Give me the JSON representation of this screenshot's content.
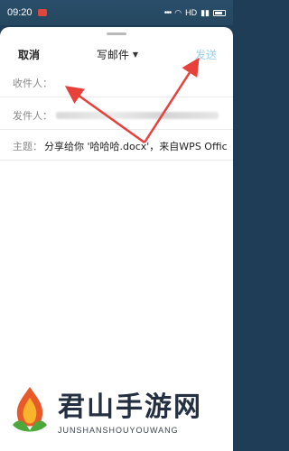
{
  "status_bar": {
    "time": "09:20",
    "network": "HD"
  },
  "header": {
    "cancel_label": "取消",
    "title": "写邮件",
    "send_label": "发送"
  },
  "fields": {
    "to_label": "收件人：",
    "from_label": "发件人：",
    "subject_label": "主题：",
    "subject_value": "分享给你 '哈哈哈.docx'，来自WPS Offic"
  },
  "watermark": {
    "title": "君山手游网",
    "subtitle": "JUNSHANSHOUYOUWANG"
  },
  "colors": {
    "send_disabled": "#9bd0f0",
    "arrow": "#e8403a"
  }
}
